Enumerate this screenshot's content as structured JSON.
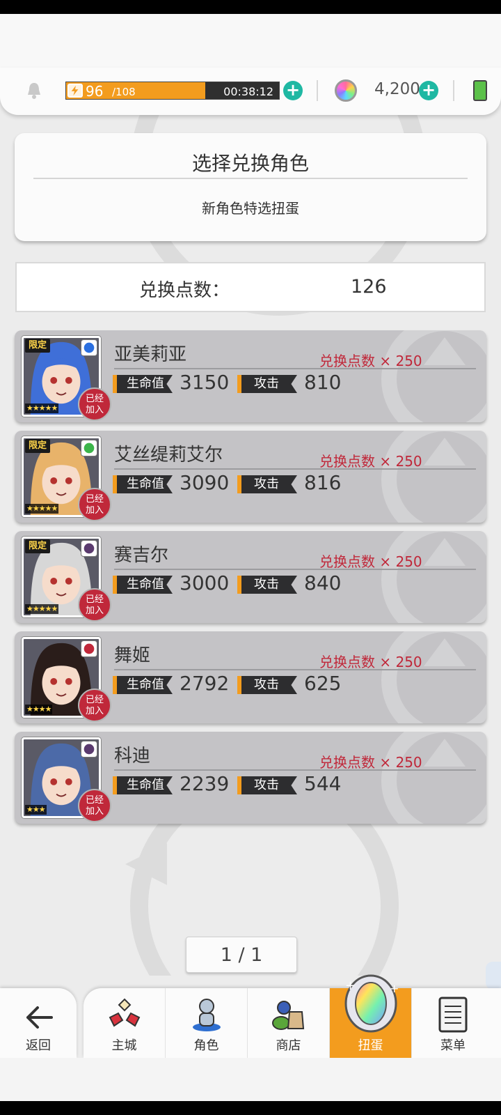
{
  "topbar": {
    "stamina_current": "96",
    "stamina_max": "/108",
    "stamina_fraction": 0.75,
    "stamina_timer": "00:38:12",
    "gems": "4,200"
  },
  "title_panel": {
    "title": "选择兑换角色",
    "subtitle": "新角色特选扭蛋"
  },
  "points": {
    "label": "兑换点数：",
    "value": "126"
  },
  "characters": [
    {
      "name": "亚美莉亚",
      "cost": "兑换点数 × 250",
      "hp_label": "生命值",
      "hp": "3150",
      "atk_label": "攻击",
      "atk": "810",
      "limited": "限定",
      "stars": "★★★★★",
      "joined": "已经加入",
      "element_color": "#2a6fe0",
      "hair": "#3f6fd8"
    },
    {
      "name": "艾丝缇莉艾尔",
      "cost": "兑换点数 × 250",
      "hp_label": "生命值",
      "hp": "3090",
      "atk_label": "攻击",
      "atk": "816",
      "limited": "限定",
      "stars": "★★★★★",
      "joined": "已经加入",
      "element_color": "#3bb54a",
      "hair": "#e8b36a"
    },
    {
      "name": "赛吉尔",
      "cost": "兑换点数 × 250",
      "hp_label": "生命值",
      "hp": "3000",
      "atk_label": "攻击",
      "atk": "840",
      "limited": "限定",
      "stars": "★★★★★",
      "joined": "已经加入",
      "element_color": "#5a3a6e",
      "hair": "#d7d7d7"
    },
    {
      "name": "舞姬",
      "cost": "兑换点数 × 250",
      "hp_label": "生命值",
      "hp": "2792",
      "atk_label": "攻击",
      "atk": "625",
      "limited": "",
      "stars": "★★★★",
      "joined": "已经加入",
      "element_color": "#c0283a",
      "hair": "#2a1d1a"
    },
    {
      "name": "科迪",
      "cost": "兑换点数 × 250",
      "hp_label": "生命值",
      "hp": "2239",
      "atk_label": "攻击",
      "atk": "544",
      "limited": "",
      "stars": "★★★",
      "joined": "已经加入",
      "element_color": "#5a3a6e",
      "hair": "#4c6aa8"
    }
  ],
  "pagination": "1 / 1",
  "nav": {
    "back": "返回",
    "items": [
      {
        "label": "主城"
      },
      {
        "label": "角色"
      },
      {
        "label": "商店"
      },
      {
        "label": "扭蛋"
      },
      {
        "label": "菜单"
      }
    ]
  }
}
